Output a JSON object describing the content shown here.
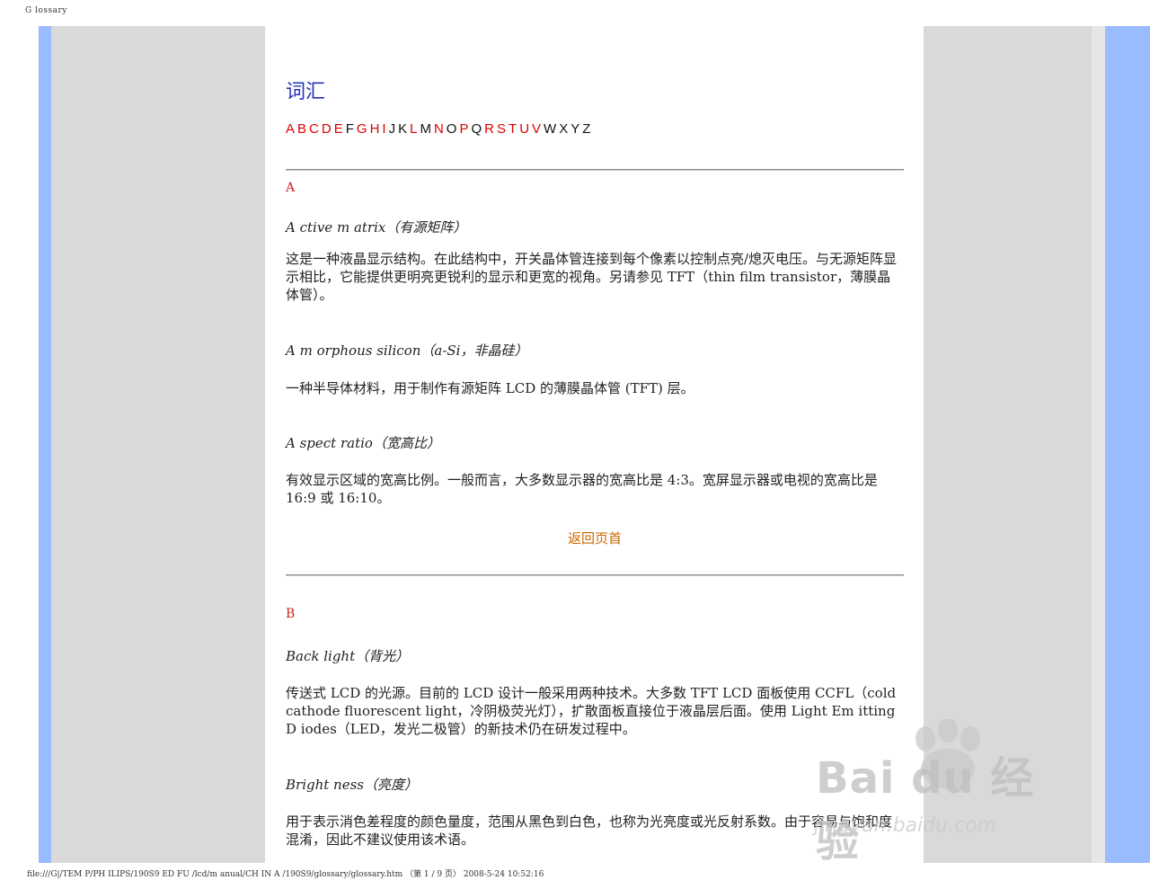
{
  "print_header": "G lossary",
  "print_footer": "file:///G|/TEM P/PH ILIPS/190S9 ED FU /lcd/m anual/CH IN A /190S9/glossary/glossary.htm （第 1 / 9 页） 2008-5-24 10:52:16",
  "page": {
    "title": "词汇",
    "alphabet": [
      {
        "letter": "A",
        "link": true
      },
      {
        "letter": "B",
        "link": true
      },
      {
        "letter": "C",
        "link": true
      },
      {
        "letter": "D",
        "link": true
      },
      {
        "letter": "E",
        "link": true
      },
      {
        "letter": "F",
        "link": false
      },
      {
        "letter": "G",
        "link": true
      },
      {
        "letter": "H",
        "link": true
      },
      {
        "letter": "I",
        "link": true
      },
      {
        "letter": "J",
        "link": false
      },
      {
        "letter": "K",
        "link": false
      },
      {
        "letter": "L",
        "link": true
      },
      {
        "letter": "M",
        "link": false
      },
      {
        "letter": "N",
        "link": true
      },
      {
        "letter": "O",
        "link": false
      },
      {
        "letter": "P",
        "link": true
      },
      {
        "letter": "Q",
        "link": false
      },
      {
        "letter": "R",
        "link": true
      },
      {
        "letter": "S",
        "link": true
      },
      {
        "letter": "T",
        "link": true
      },
      {
        "letter": "U",
        "link": true
      },
      {
        "letter": "V",
        "link": true
      },
      {
        "letter": "W",
        "link": false
      },
      {
        "letter": "X",
        "link": false
      },
      {
        "letter": "Y",
        "link": false
      },
      {
        "letter": "Z",
        "link": false
      }
    ],
    "colors": {
      "link": "#dd0000",
      "title": "#2233bb",
      "back_link": "#cc6600",
      "side_blue": "#99bbff",
      "side_gray": "#d9d9d9"
    }
  },
  "sections": {
    "a": {
      "letter": "A",
      "entries": [
        {
          "term": "A ctive m atrix（有源矩阵）",
          "desc": "这是一种液晶显示结构。在此结构中，开关晶体管连接到每个像素以控制点亮/熄灭电压。与无源矩阵显示相比，它能提供更明亮更锐利的显示和更宽的视角。另请参见 TFT（thin film transistor，薄膜晶体管）。"
        },
        {
          "term": "A m orphous silicon（a-Si，非晶硅）",
          "desc": "一种半导体材料，用于制作有源矩阵 LCD 的薄膜晶体管 (TFT) 层。"
        },
        {
          "term": "A spect ratio（宽高比）",
          "desc": "有效显示区域的宽高比例。一般而言，大多数显示器的宽高比是 4:3。宽屏显示器或电视的宽高比是 16:9 或 16:10。"
        }
      ],
      "back_to_top": "返回页首"
    },
    "b": {
      "letter": "B",
      "entries": [
        {
          "term": "Back light（背光）",
          "desc": "传送式 LCD 的光源。目前的 LCD 设计一般采用两种技术。大多数 TFT LCD 面板使用 CCFL（cold cathode fluorescent light，冷阴极荧光灯），扩散面板直接位于液晶层后面。使用 Light Em itting D iodes（LED，发光二极管）的新技术仍在研发过程中。"
        },
        {
          "term": "Bright ness（亮度）",
          "desc": "用于表示消色差程度的颜色量度，范围从黑色到白色，也称为光亮度或光反射系数。由于容易与饱和度混淆，因此不建议使用该术语。"
        }
      ]
    }
  },
  "watermark": {
    "brand": "Bai du 经验",
    "url": "jingyan.baidu.com"
  }
}
